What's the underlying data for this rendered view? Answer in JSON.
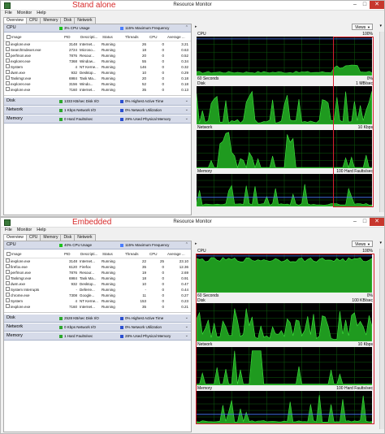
{
  "colors": {
    "cpu_green": "#1dc21d",
    "grid": "#0e5c0e",
    "frequency_blue": "#4a7dff",
    "highlight_red": "#d61f2f",
    "disk_green": "#2da82d"
  },
  "windows": [
    {
      "caption": "Stand alone",
      "title": "Resource Monitor",
      "menu": [
        "File",
        "Monitor",
        "Help"
      ],
      "tabs": [
        "Overview",
        "CPU",
        "Memory",
        "Disk",
        "Network"
      ],
      "cpu": {
        "title": "CPU",
        "usage": "3% CPU Usage",
        "frequency": "115% Maximum Frequency",
        "columns": [
          "Image",
          "PID",
          "Descripti...",
          "Status",
          "Threads",
          "CPU",
          "Average ..."
        ],
        "rows": [
          [
            "iexplore.exe",
            "3148",
            "Internet...",
            "Running",
            "26",
            "0",
            "3.21"
          ],
          [
            "SearchIndexer.exe",
            "2724",
            "Microso...",
            "Running",
            "18",
            "0",
            "0.63"
          ],
          [
            "perfmon.exe",
            "7876",
            "Resour...",
            "Running",
            "20",
            "0",
            "0.52"
          ],
          [
            "explorer.exe",
            "7368",
            "Window...",
            "Running",
            "55",
            "0",
            "0.34"
          ],
          [
            "System",
            "4",
            "NT Kerne...",
            "Running",
            "146",
            "0",
            "0.32"
          ],
          [
            "dwm.exe",
            "932",
            "Desktop...",
            "Running",
            "10",
            "0",
            "0.29"
          ],
          [
            "Taskmgr.exe",
            "6984",
            "Task Ma...",
            "Running",
            "20",
            "0",
            "0.18"
          ],
          [
            "explorer.exe",
            "3156",
            "Windo...",
            "Running",
            "52",
            "0",
            "0.18"
          ],
          [
            "iexplore.exe",
            "7160",
            "Internet...",
            "Running",
            "35",
            "0",
            "0.13"
          ]
        ]
      },
      "disk": {
        "title": "Disk",
        "stat1": "1333 KB/sec Disk I/O",
        "stat2": "0% Highest Active Time"
      },
      "network": {
        "title": "Network",
        "stat1": "1 Kbps Network I/O",
        "stat2": "0% Network Utilization"
      },
      "memory": {
        "title": "Memory",
        "stat1": "0 Hard Faults/sec",
        "stat2": "29% Used Physical Memory"
      },
      "graphs": {
        "views_label": "Views",
        "cpu_label": "CPU",
        "cpu_max": "100%",
        "seconds_label": "60 Seconds",
        "cpu_min": "0%",
        "disk_label": "Disk",
        "disk_max": "1 MB/sec",
        "network_label": "Network",
        "network_max": "10 Kbps",
        "memory_label": "Memory",
        "memory_max": "100 Hard Faults/sec"
      }
    },
    {
      "caption": "Embedded",
      "title": "Resource Monitor",
      "menu": [
        "File",
        "Monitor",
        "Help"
      ],
      "tabs": [
        "Overview",
        "CPU",
        "Memory",
        "Disk",
        "Network"
      ],
      "cpu": {
        "title": "CPU",
        "usage": "40% CPU Usage",
        "frequency": "115% Maximum Frequency",
        "columns": [
          "Image",
          "PID",
          "Descripti...",
          "Status",
          "Threads",
          "CPU",
          "Average ..."
        ],
        "rows": [
          [
            "iexplore.exe",
            "3148",
            "Internet...",
            "Running",
            "22",
            "25",
            "23.10"
          ],
          [
            "firefox.exe",
            "6120",
            "Firefox",
            "Running",
            "35",
            "0",
            "12.36"
          ],
          [
            "perfmon.exe",
            "7876",
            "Resour...",
            "Running",
            "19",
            "0",
            "2.69"
          ],
          [
            "Taskmgr.exe",
            "6984",
            "Task Ma...",
            "Running",
            "18",
            "0",
            "0.91"
          ],
          [
            "dwm.exe",
            "932",
            "Desktop...",
            "Running",
            "10",
            "0",
            "0.47"
          ],
          [
            "System Interrupts",
            "-",
            "Deferre...",
            "Running",
            "-",
            "0",
            "0.44"
          ],
          [
            "chrome.exe",
            "7308",
            "Google...",
            "Running",
            "11",
            "0",
            "0.27"
          ],
          [
            "System",
            "4",
            "NT Kerne...",
            "Running",
            "153",
            "0",
            "0.23"
          ],
          [
            "iexplore.exe",
            "7160",
            "Internet...",
            "Running",
            "35",
            "0",
            "0.21"
          ]
        ]
      },
      "disk": {
        "title": "Disk",
        "stat1": "2528 KB/sec Disk I/O",
        "stat2": "0% Highest Active Time"
      },
      "network": {
        "title": "Network",
        "stat1": "0 Kbps Network I/O",
        "stat2": "0% Network Utilization"
      },
      "memory": {
        "title": "Memory",
        "stat1": "1 Hard Faults/sec",
        "stat2": "28% Used Physical Memory"
      },
      "graphs": {
        "views_label": "Views",
        "cpu_label": "CPU",
        "cpu_max": "100%",
        "seconds_label": "60 Seconds",
        "cpu_min": "0%",
        "disk_label": "Disk",
        "disk_max": "100 KB/sec",
        "network_label": "Network",
        "network_max": "10 Kbps",
        "memory_label": "Memory",
        "memory_max": "100 Hard Faults/sec"
      }
    }
  ]
}
